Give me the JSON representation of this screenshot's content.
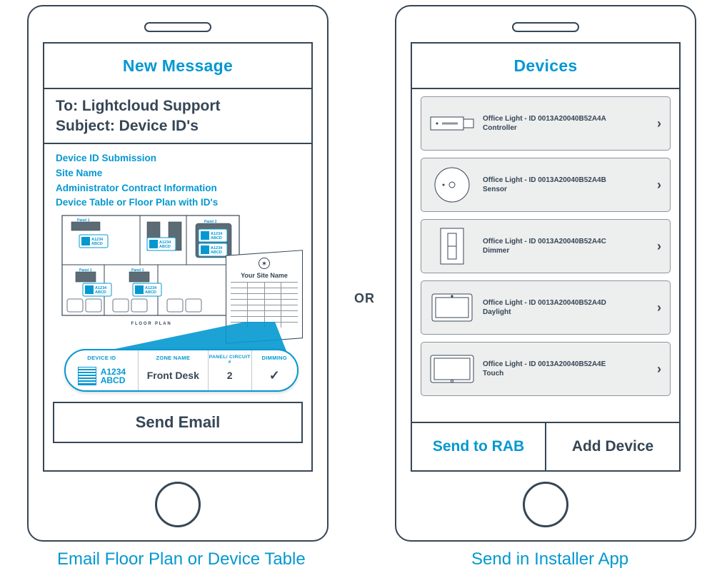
{
  "or_text": "OR",
  "left_phone": {
    "header": "New Message",
    "to_line": "To: Lightcloud Support",
    "subject_line": "Subject: Device ID's",
    "body_lines": {
      "a": "Device ID Submission",
      "b": "Site Name",
      "c": "Administrator Contract Information",
      "d": "Device Table or Floor Plan with ID's"
    },
    "plan_caption": "FLOOR PLAN",
    "sheet_title": "Your Site Name",
    "zoom": {
      "head_device": "DEVICE ID",
      "head_zone": "ZONE NAME",
      "head_panel": "PANEL/ CIRCUIT #",
      "head_dim": "DIMMING",
      "qr_l1": "A1234",
      "qr_l2": "ABCD",
      "zone": "Front Desk",
      "panel": "2",
      "dim_check": "✓"
    },
    "send_button": "Send Email",
    "caption": "Email Floor Plan or Device Table"
  },
  "right_phone": {
    "header": "Devices",
    "devices": [
      {
        "title": "Office Light - ID 0013A20040B52A4A",
        "type": "Controller"
      },
      {
        "title": "Office Light - ID 0013A20040B52A4B",
        "type": "Sensor"
      },
      {
        "title": "Office Light - ID 0013A20040B52A4C",
        "type": "Dimmer"
      },
      {
        "title": "Office Light - ID 0013A20040B52A4D",
        "type": "Daylight"
      },
      {
        "title": "Office Light - ID 0013A20040B52A4E",
        "type": "Touch"
      }
    ],
    "send_button": "Send to RAB",
    "add_button": "Add Device",
    "caption": "Send in Installer App"
  }
}
